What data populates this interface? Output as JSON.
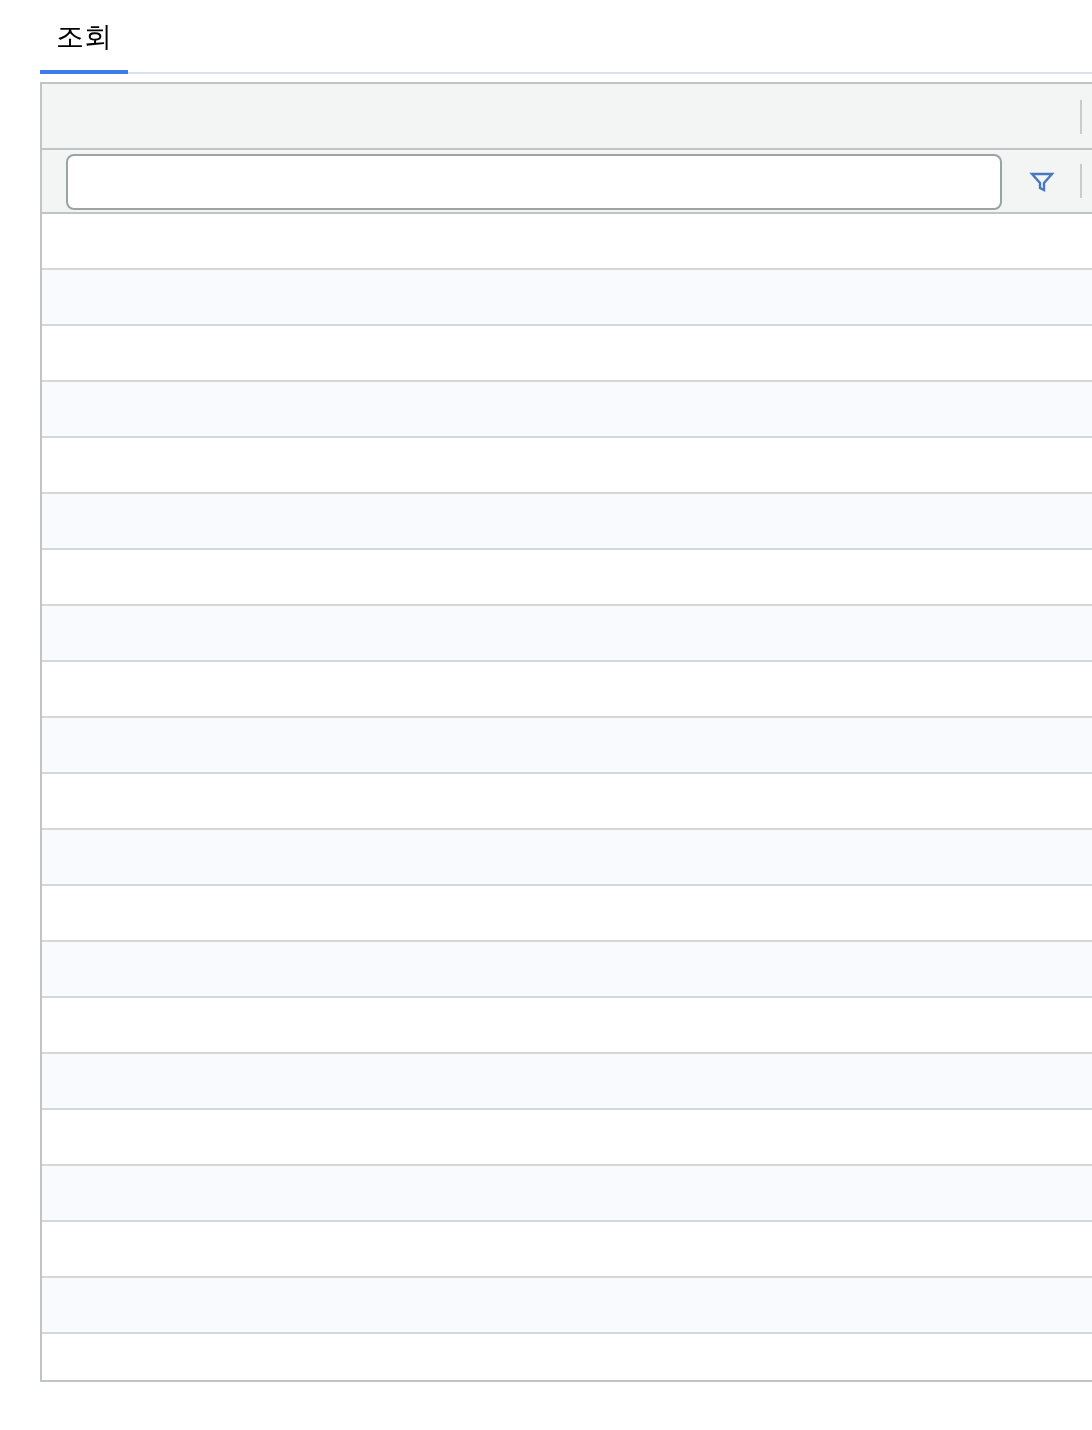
{
  "tabs": [
    {
      "label": "조회",
      "selected": true
    }
  ]
}
